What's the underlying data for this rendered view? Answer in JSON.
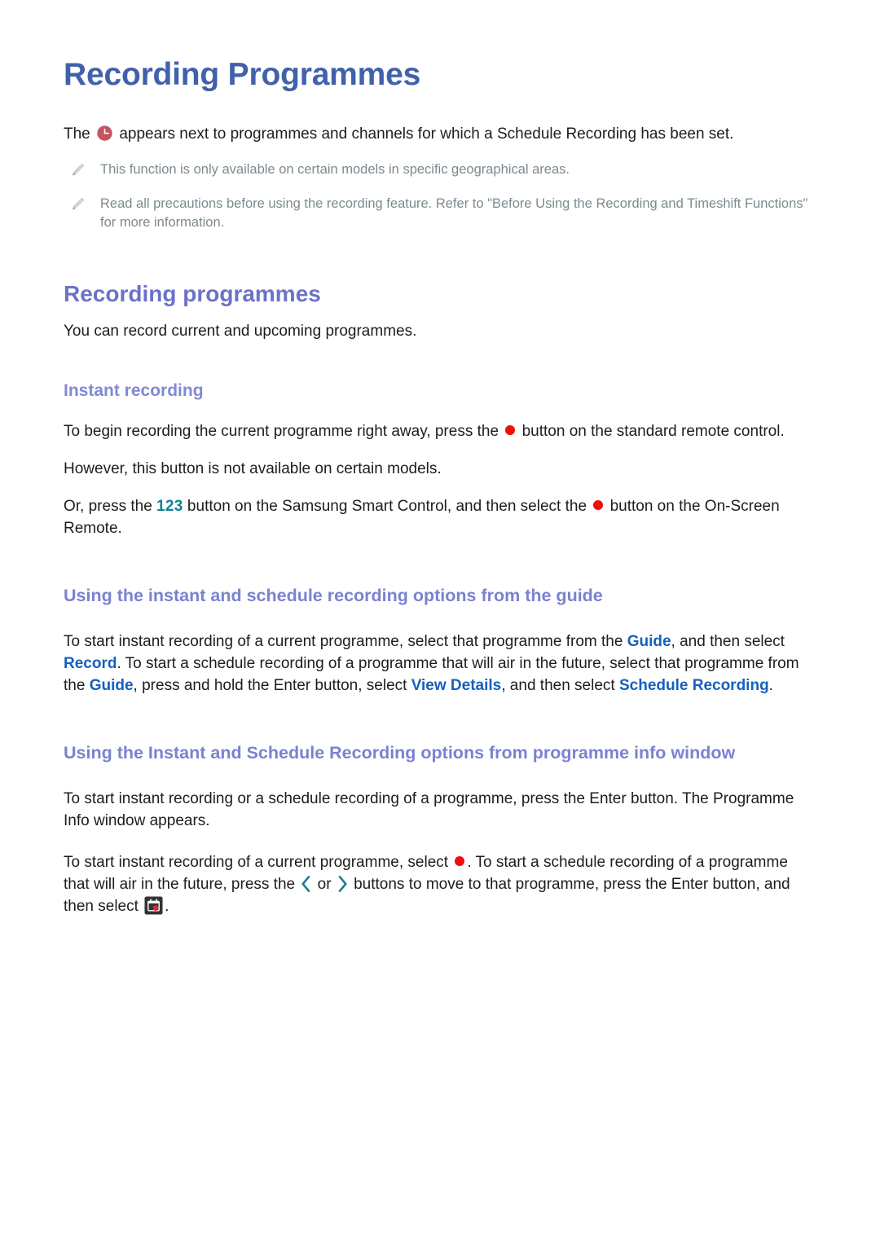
{
  "page": {
    "title": "Recording Programmes",
    "intro": {
      "before_icon": "The",
      "icon": "clock-icon",
      "after_icon": "appears next to programmes and channels for which a Schedule Recording has been set."
    },
    "notes": [
      {
        "icon": "pencil-icon",
        "text": "This function is only available on certain models in specific geographical areas."
      },
      {
        "icon": "pencil-icon",
        "text": "Read all precautions before using the recording feature. Refer to \"Before Using the Recording and Timeshift Functions\" for more information."
      }
    ],
    "sections": [
      {
        "id": "recording-programmes",
        "heading": "Recording programmes",
        "lead": "You can record current and upcoming programmes.",
        "subsections": [
          {
            "id": "instant-recording",
            "heading": "Instant recording",
            "paragraphs": [
              {
                "id": "instant-p1",
                "parts": [
                  {
                    "type": "text",
                    "value": "To begin recording the current programme right away, press the "
                  },
                  {
                    "type": "icon",
                    "value": "red-record-dot-icon"
                  },
                  {
                    "type": "text",
                    "value": " button on the standard remote control."
                  }
                ]
              },
              {
                "id": "instant-p2",
                "parts": [
                  {
                    "type": "text",
                    "value": "However, this button is not available on certain models."
                  }
                ]
              },
              {
                "id": "instant-p3",
                "parts": [
                  {
                    "type": "text",
                    "value": "Or, press the "
                  },
                  {
                    "type": "number-key",
                    "value": "123"
                  },
                  {
                    "type": "text",
                    "value": " button on the Samsung Smart Control, and then select the "
                  },
                  {
                    "type": "icon",
                    "value": "red-record-dot-icon"
                  },
                  {
                    "type": "text",
                    "value": " button on the On-Screen Remote."
                  }
                ]
              }
            ]
          }
        ]
      },
      {
        "id": "guide-options",
        "heading": "Using the instant and schedule recording options from the guide",
        "paragraph_parts": [
          {
            "type": "text",
            "value": "To start instant recording of a current programme, select that programme from the "
          },
          {
            "type": "keyword",
            "value": "Guide"
          },
          {
            "type": "text",
            "value": ", and then select "
          },
          {
            "type": "keyword",
            "value": "Record"
          },
          {
            "type": "text",
            "value": ". To start a schedule recording of a programme that will air in the future, select that programme from the "
          },
          {
            "type": "keyword",
            "value": "Guide"
          },
          {
            "type": "text",
            "value": ", press and hold the Enter button, select "
          },
          {
            "type": "keyword",
            "value": "View Details"
          },
          {
            "type": "text",
            "value": ", and then select "
          },
          {
            "type": "keyword",
            "value": "Schedule Recording"
          },
          {
            "type": "text",
            "value": "."
          }
        ]
      },
      {
        "id": "info-window-options",
        "heading": "Using the Instant and Schedule Recording options from programme info window",
        "paragraphs": [
          {
            "id": "info-p1",
            "parts": [
              {
                "type": "text",
                "value": "To start instant recording or a schedule recording of a programme, press the Enter button. The Programme Info window appears."
              }
            ]
          },
          {
            "id": "info-p2",
            "parts": [
              {
                "type": "text",
                "value": "To start instant recording of a current programme, select "
              },
              {
                "type": "icon",
                "value": "red-record-dot-icon"
              },
              {
                "type": "text",
                "value": ". To start a schedule recording of a programme that will air in the future, press the "
              },
              {
                "type": "icon",
                "value": "chevron-left-icon"
              },
              {
                "type": "text",
                "value": " or "
              },
              {
                "type": "icon",
                "value": "chevron-right-icon"
              },
              {
                "type": "text",
                "value": " buttons to move to that programme, press the Enter button, and then select "
              },
              {
                "type": "icon",
                "value": "schedule-recording-badge-icon"
              },
              {
                "type": "text",
                "value": "."
              }
            ]
          }
        ]
      }
    ],
    "colors": {
      "title": "#4161ab",
      "heading2": "#6b72c8",
      "heading3": "#8189d4",
      "keyword": "#1560bd",
      "number_key": "#128296",
      "record_dot": "#f30c0c",
      "clock_icon": "#c4555f",
      "note_text": "#7c8a8f",
      "body_text": "#1d1d1d",
      "background": "#ffffff"
    }
  }
}
